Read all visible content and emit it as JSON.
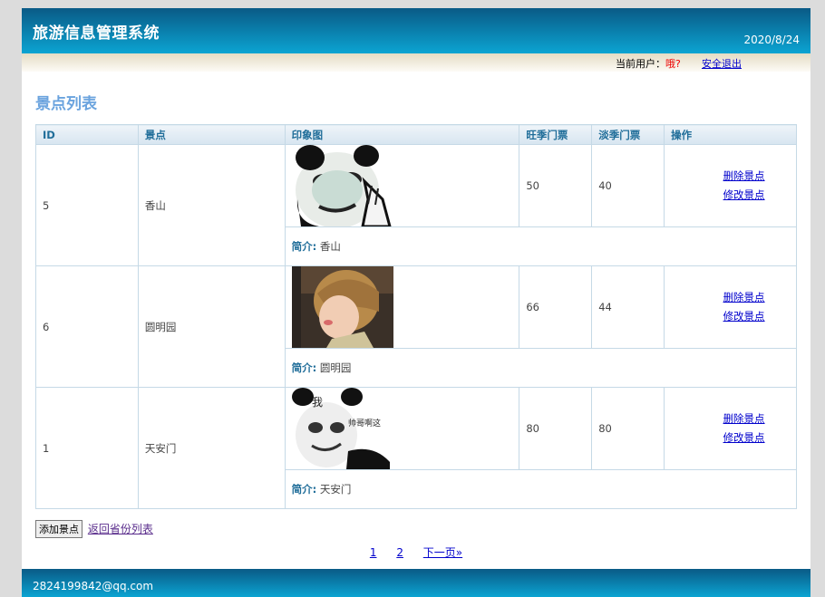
{
  "header": {
    "title": "旅游信息管理系统",
    "date": "2020/8/24"
  },
  "userbar": {
    "label": "当前用户：",
    "username": "哦?",
    "logout": "安全退出"
  },
  "section_title": "景点列表",
  "table": {
    "columns": [
      "ID",
      "景点",
      "印象图",
      "旺季门票",
      "淡季门票",
      "操作"
    ],
    "rows": [
      {
        "id": "5",
        "name": "香山",
        "peak": "50",
        "off": "40",
        "intro_label": "简介:",
        "intro": "香山",
        "op_delete": "删除景点",
        "op_edit": "修改景点"
      },
      {
        "id": "6",
        "name": "圆明园",
        "peak": "66",
        "off": "44",
        "intro_label": "简介:",
        "intro": "圆明园",
        "op_delete": "删除景点",
        "op_edit": "修改景点"
      },
      {
        "id": "1",
        "name": "天安门",
        "peak": "80",
        "off": "80",
        "intro_label": "简介:",
        "intro": "天安门",
        "op_delete": "删除景点",
        "op_edit": "修改景点",
        "image_caption_1": "我",
        "image_caption_2": "帅哥啊这"
      }
    ]
  },
  "actions": {
    "add": "添加景点",
    "back": "返回省份列表"
  },
  "pager": {
    "page1": "1",
    "page2": "2",
    "next": "下一页»"
  },
  "footer": {
    "email": "2824199842@qq.com"
  }
}
